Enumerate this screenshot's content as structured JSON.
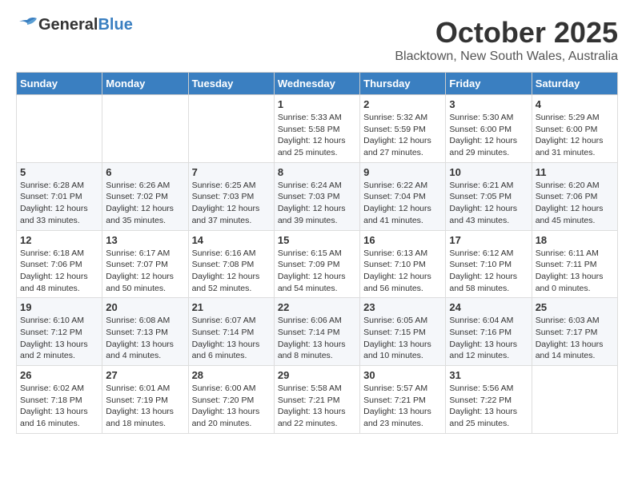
{
  "header": {
    "logo_general": "General",
    "logo_blue": "Blue",
    "title": "October 2025",
    "subtitle": "Blacktown, New South Wales, Australia"
  },
  "calendar": {
    "days_of_week": [
      "Sunday",
      "Monday",
      "Tuesday",
      "Wednesday",
      "Thursday",
      "Friday",
      "Saturday"
    ],
    "weeks": [
      [
        {
          "day": "",
          "info": ""
        },
        {
          "day": "",
          "info": ""
        },
        {
          "day": "",
          "info": ""
        },
        {
          "day": "1",
          "info": "Sunrise: 5:33 AM\nSunset: 5:58 PM\nDaylight: 12 hours\nand 25 minutes."
        },
        {
          "day": "2",
          "info": "Sunrise: 5:32 AM\nSunset: 5:59 PM\nDaylight: 12 hours\nand 27 minutes."
        },
        {
          "day": "3",
          "info": "Sunrise: 5:30 AM\nSunset: 6:00 PM\nDaylight: 12 hours\nand 29 minutes."
        },
        {
          "day": "4",
          "info": "Sunrise: 5:29 AM\nSunset: 6:00 PM\nDaylight: 12 hours\nand 31 minutes."
        }
      ],
      [
        {
          "day": "5",
          "info": "Sunrise: 6:28 AM\nSunset: 7:01 PM\nDaylight: 12 hours\nand 33 minutes."
        },
        {
          "day": "6",
          "info": "Sunrise: 6:26 AM\nSunset: 7:02 PM\nDaylight: 12 hours\nand 35 minutes."
        },
        {
          "day": "7",
          "info": "Sunrise: 6:25 AM\nSunset: 7:03 PM\nDaylight: 12 hours\nand 37 minutes."
        },
        {
          "day": "8",
          "info": "Sunrise: 6:24 AM\nSunset: 7:03 PM\nDaylight: 12 hours\nand 39 minutes."
        },
        {
          "day": "9",
          "info": "Sunrise: 6:22 AM\nSunset: 7:04 PM\nDaylight: 12 hours\nand 41 minutes."
        },
        {
          "day": "10",
          "info": "Sunrise: 6:21 AM\nSunset: 7:05 PM\nDaylight: 12 hours\nand 43 minutes."
        },
        {
          "day": "11",
          "info": "Sunrise: 6:20 AM\nSunset: 7:06 PM\nDaylight: 12 hours\nand 45 minutes."
        }
      ],
      [
        {
          "day": "12",
          "info": "Sunrise: 6:18 AM\nSunset: 7:06 PM\nDaylight: 12 hours\nand 48 minutes."
        },
        {
          "day": "13",
          "info": "Sunrise: 6:17 AM\nSunset: 7:07 PM\nDaylight: 12 hours\nand 50 minutes."
        },
        {
          "day": "14",
          "info": "Sunrise: 6:16 AM\nSunset: 7:08 PM\nDaylight: 12 hours\nand 52 minutes."
        },
        {
          "day": "15",
          "info": "Sunrise: 6:15 AM\nSunset: 7:09 PM\nDaylight: 12 hours\nand 54 minutes."
        },
        {
          "day": "16",
          "info": "Sunrise: 6:13 AM\nSunset: 7:10 PM\nDaylight: 12 hours\nand 56 minutes."
        },
        {
          "day": "17",
          "info": "Sunrise: 6:12 AM\nSunset: 7:10 PM\nDaylight: 12 hours\nand 58 minutes."
        },
        {
          "day": "18",
          "info": "Sunrise: 6:11 AM\nSunset: 7:11 PM\nDaylight: 13 hours\nand 0 minutes."
        }
      ],
      [
        {
          "day": "19",
          "info": "Sunrise: 6:10 AM\nSunset: 7:12 PM\nDaylight: 13 hours\nand 2 minutes."
        },
        {
          "day": "20",
          "info": "Sunrise: 6:08 AM\nSunset: 7:13 PM\nDaylight: 13 hours\nand 4 minutes."
        },
        {
          "day": "21",
          "info": "Sunrise: 6:07 AM\nSunset: 7:14 PM\nDaylight: 13 hours\nand 6 minutes."
        },
        {
          "day": "22",
          "info": "Sunrise: 6:06 AM\nSunset: 7:14 PM\nDaylight: 13 hours\nand 8 minutes."
        },
        {
          "day": "23",
          "info": "Sunrise: 6:05 AM\nSunset: 7:15 PM\nDaylight: 13 hours\nand 10 minutes."
        },
        {
          "day": "24",
          "info": "Sunrise: 6:04 AM\nSunset: 7:16 PM\nDaylight: 13 hours\nand 12 minutes."
        },
        {
          "day": "25",
          "info": "Sunrise: 6:03 AM\nSunset: 7:17 PM\nDaylight: 13 hours\nand 14 minutes."
        }
      ],
      [
        {
          "day": "26",
          "info": "Sunrise: 6:02 AM\nSunset: 7:18 PM\nDaylight: 13 hours\nand 16 minutes."
        },
        {
          "day": "27",
          "info": "Sunrise: 6:01 AM\nSunset: 7:19 PM\nDaylight: 13 hours\nand 18 minutes."
        },
        {
          "day": "28",
          "info": "Sunrise: 6:00 AM\nSunset: 7:20 PM\nDaylight: 13 hours\nand 20 minutes."
        },
        {
          "day": "29",
          "info": "Sunrise: 5:58 AM\nSunset: 7:21 PM\nDaylight: 13 hours\nand 22 minutes."
        },
        {
          "day": "30",
          "info": "Sunrise: 5:57 AM\nSunset: 7:21 PM\nDaylight: 13 hours\nand 23 minutes."
        },
        {
          "day": "31",
          "info": "Sunrise: 5:56 AM\nSunset: 7:22 PM\nDaylight: 13 hours\nand 25 minutes."
        },
        {
          "day": "",
          "info": ""
        }
      ]
    ]
  }
}
